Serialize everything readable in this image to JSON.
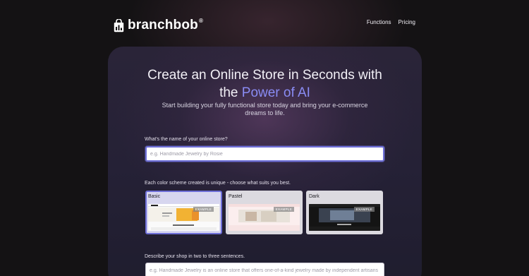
{
  "brand": {
    "name": "branchbob",
    "registered": "®"
  },
  "nav": {
    "items": [
      "Functions",
      "Pricing"
    ]
  },
  "hero": {
    "title_line1": "Create an Online Store in Seconds with",
    "title_line2_prefix": "the ",
    "title_line2_accent": "Power of AI",
    "subtitle": "Start building your fully functional store today and bring your e-commerce dreams to life."
  },
  "store_name": {
    "label": "What's the name of your online store?",
    "placeholder": "e.g. Handmade Jewelry by Rosie",
    "value": ""
  },
  "color_scheme": {
    "label": "Each color scheme created is unique - choose what suits you best.",
    "selected": "Basic",
    "options": [
      {
        "name": "Basic",
        "badge": "EXAMPLE"
      },
      {
        "name": "Pastel",
        "badge": "EXAMPLE"
      },
      {
        "name": "Dark",
        "badge": "EXAMPLE"
      }
    ]
  },
  "description": {
    "label": "Describe your shop in two to three sentences.",
    "placeholder": "e.g. Handmade Jewelry is an online store that offers one-of-a-kind jewelry made by independent artisans",
    "value": ""
  },
  "colors": {
    "accent": "#8a8cf4",
    "border_focus": "#6e6fd8",
    "background": "#141214"
  }
}
